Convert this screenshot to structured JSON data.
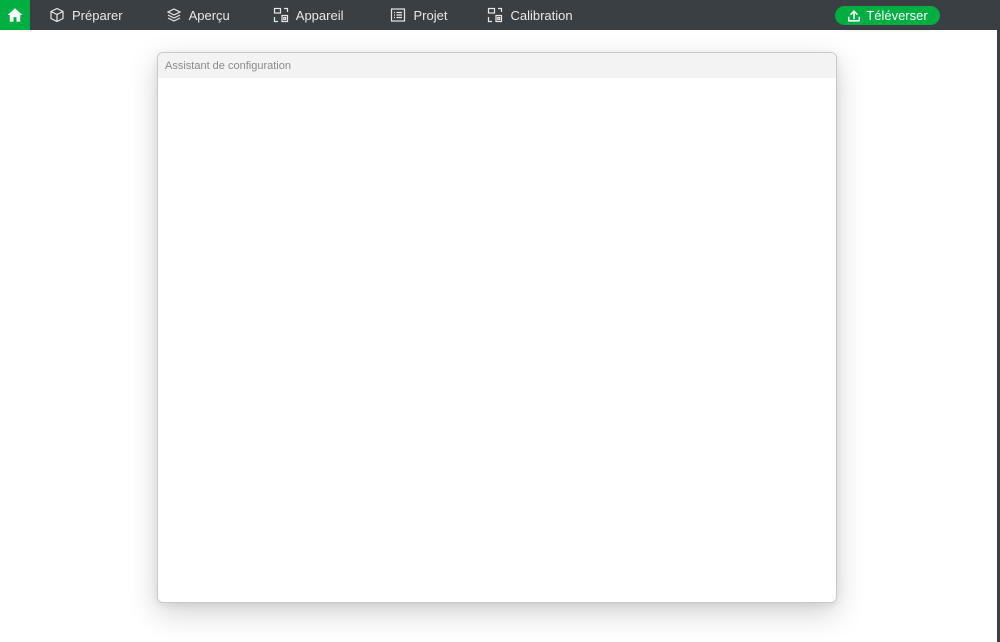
{
  "topbar": {
    "home": {
      "icon": "home-icon"
    },
    "nav": [
      {
        "key": "prep",
        "label": "Préparer",
        "icon": "cube-icon"
      },
      {
        "key": "apercu",
        "label": "Aperçu",
        "icon": "layers-icon"
      },
      {
        "key": "appareil",
        "label": "Appareil",
        "icon": "device-icon"
      },
      {
        "key": "projet",
        "label": "Projet",
        "icon": "project-icon"
      },
      {
        "key": "calib",
        "label": "Calibration",
        "icon": "calibration-icon"
      }
    ],
    "upload_label": "Téléverser",
    "upload_icon": "upload-icon"
  },
  "dialog": {
    "title": "Assistant de configuration"
  },
  "colors": {
    "topbar_bg": "#3a3f43",
    "accent": "#00ae42",
    "nav_text": "#e8e8e8"
  }
}
